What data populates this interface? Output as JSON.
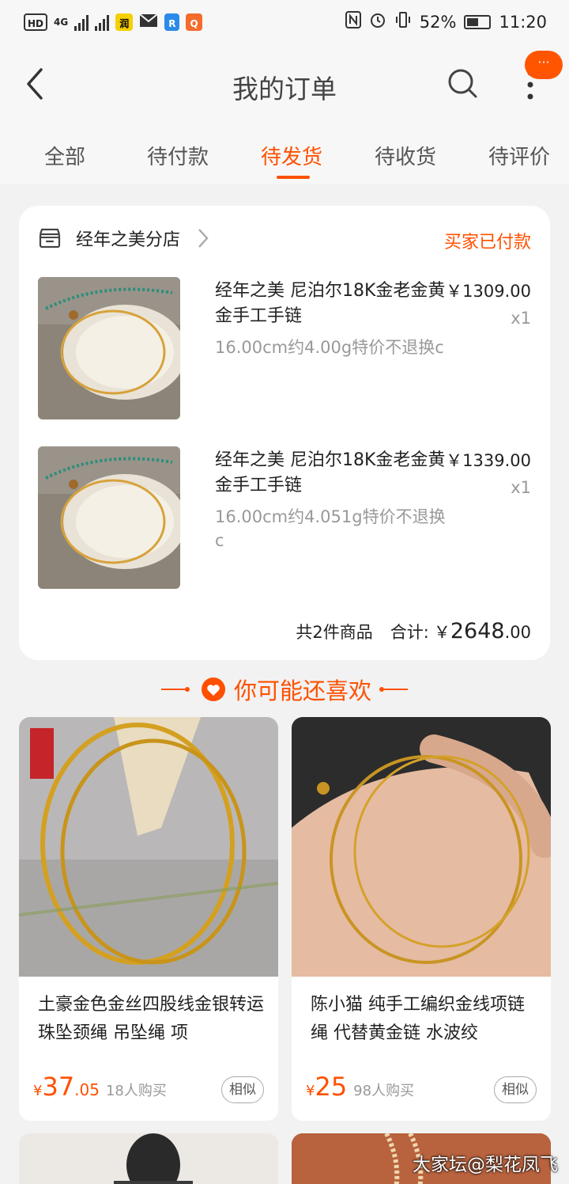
{
  "status_bar": {
    "left_text": "HD",
    "network": "4G",
    "battery": "52%",
    "time": "11:20"
  },
  "header": {
    "title": "我的订单",
    "more_badge": "···"
  },
  "tabs": [
    "全部",
    "待付款",
    "待发货",
    "待收货",
    "待评价"
  ],
  "active_tab": 2,
  "order": {
    "shop_name": "经年之美分店",
    "status": "买家已付款",
    "items": [
      {
        "title": "经年之美  尼泊尔18K金老金黄金手工手链",
        "sku": "16.00cm约4.00g特价不退换c",
        "price": "￥1309.00",
        "qty": "x1"
      },
      {
        "title": "经年之美  尼泊尔18K金老金黄金手工手链",
        "sku": "16.00cm约4.051g特价不退换c",
        "price": "￥1339.00",
        "qty": "x1"
      }
    ],
    "count_text": "共2件商品",
    "total_label": "合计:",
    "total_yen": "￥",
    "total_int": "2648",
    "total_dec": ".00"
  },
  "recommend": {
    "title": "你可能还喜欢",
    "items": [
      {
        "name": "土豪金色金丝四股线金银转运珠坠颈绳 吊坠绳 项",
        "yen": "¥",
        "price_int": "37",
        "price_dec": ".05",
        "sold": "18人购买",
        "similar": "相似"
      },
      {
        "name": "陈小猫 纯手工编织金线项链绳 代替黄金链 水波绞",
        "yen": "¥",
        "price_int": "25",
        "price_dec": "",
        "sold": "98人购买",
        "similar": "相似"
      }
    ]
  },
  "watermark": "大家坛@梨花凤飞",
  "colors": {
    "accent": "#ff5000",
    "page_bg": "#f2f2f2",
    "card_bg": "#ffffff"
  }
}
